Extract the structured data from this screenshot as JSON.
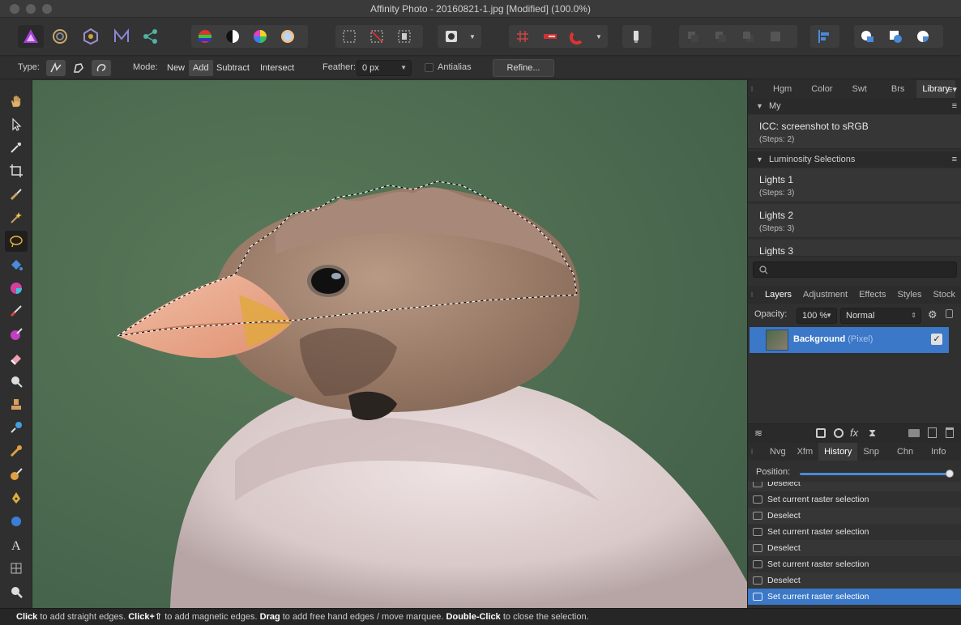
{
  "window": {
    "title": "Affinity Photo - 20160821-1.jpg [Modified] (100.0%)"
  },
  "context_toolbar": {
    "type_label": "Type:",
    "mode_label": "Mode:",
    "modes": [
      "New",
      "Add",
      "Subtract",
      "Intersect"
    ],
    "selected_mode": "Add",
    "feather_label": "Feather:",
    "feather_value": "0 px",
    "antialias_label": "Antialias",
    "refine_label": "Refine..."
  },
  "tools": [
    "hand-icon",
    "move-icon",
    "color-picker-icon",
    "crop-icon",
    "selection-brush-icon",
    "flood-select-icon",
    "freehand-selection-icon",
    "fill-icon",
    "gradient-icon",
    "paint-brush-icon",
    "color-replace-icon",
    "erase-icon",
    "dodge-icon",
    "clone-icon",
    "healing-icon",
    "blemish-icon",
    "smudge-icon",
    "pen-icon",
    "shape-icon",
    "text-icon",
    "mesh-warp-icon",
    "zoom-icon"
  ],
  "top_panel": {
    "tabs": [
      "Hgm",
      "Color",
      "Swt",
      "Brs",
      "Library"
    ],
    "active_tab": "Library",
    "section_my": "My",
    "macro_icc": {
      "name": "ICC: screenshot to sRGB",
      "steps": "(Steps: 2)"
    },
    "section_lum": "Luminosity Selections",
    "macros": [
      {
        "name": "Lights 1",
        "steps": "(Steps: 3)"
      },
      {
        "name": "Lights 2",
        "steps": "(Steps: 3)"
      },
      {
        "name": "Lights 3",
        "steps": ""
      }
    ]
  },
  "layers_panel": {
    "tabs": [
      "Layers",
      "Adjustment",
      "Effects",
      "Styles",
      "Stock"
    ],
    "active_tab": "Layers",
    "opacity_label": "Opacity:",
    "opacity_value": "100 %",
    "blend_mode": "Normal",
    "layer": {
      "name": "Background",
      "type": "(Pixel)"
    }
  },
  "history_panel": {
    "tabs": [
      "Nvg",
      "Xfm",
      "History",
      "Snp",
      "Chn",
      "Info"
    ],
    "active_tab": "History",
    "position_label": "Position:",
    "position": 1.0,
    "items": [
      "Deselect",
      "Set current raster selection",
      "Deselect",
      "Set current raster selection",
      "Deselect",
      "Set current raster selection",
      "Deselect",
      "Set current raster selection"
    ]
  },
  "status": {
    "k1": "Click",
    "t1": " to add straight edges. ",
    "k2": "Click+⇧",
    "t2": " to add magnetic edges. ",
    "k3": "Drag",
    "t3": " to add free hand edges / move marquee. ",
    "k4": "Double-Click",
    "t4": " to close the selection."
  }
}
